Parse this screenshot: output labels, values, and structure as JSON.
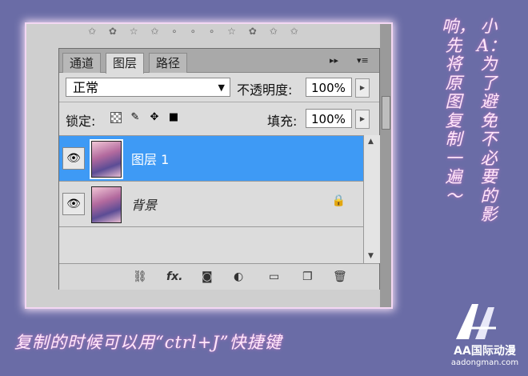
{
  "decor": {
    "stars": "✩ ✿ ☆ ✩ ∘ ∘ ∘ ☆ ✿ ✩ ✩"
  },
  "panel": {
    "tabs": [
      {
        "label": "通道",
        "active": false
      },
      {
        "label": "图层",
        "active": true
      },
      {
        "label": "路径",
        "active": false
      }
    ],
    "collapse_glyph": "▸▸",
    "menu_glyph": "▾≡",
    "blend_mode": "正常",
    "opacity_label": "不透明度:",
    "opacity_value": "100%",
    "lock_label": "锁定:",
    "fill_label": "填充:",
    "fill_value": "100%",
    "layers": [
      {
        "name": "图层 1",
        "selected": true,
        "visible": true,
        "locked": false
      },
      {
        "name": "背景",
        "selected": false,
        "visible": true,
        "locked": true
      }
    ],
    "footer_icons": [
      "link-layers-icon",
      "fx-icon",
      "add-mask-icon",
      "adjustment-layer-icon",
      "new-group-icon",
      "new-layer-icon",
      "trash-icon"
    ],
    "footer_fx": "fx."
  },
  "captions": {
    "bottom": "复制的时候可以用“ctrl+J”快捷键",
    "right_col1": "小A：为了避免不必要的影",
    "right_col2": "响，先将原图复制一遍～"
  },
  "logo": {
    "name": "AA国际动漫",
    "url": "aadongman.com"
  },
  "colors": {
    "background": "#6a6ca6",
    "selection": "#3e9af5",
    "caption": "#ffe8fb"
  }
}
